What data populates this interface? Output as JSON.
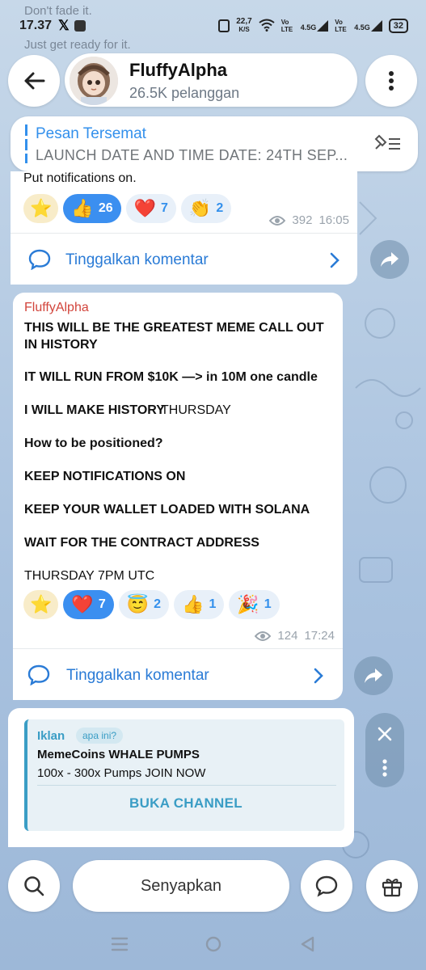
{
  "status_bar": {
    "notif_line1": "Don't fade it.",
    "notif_line2": "Just get ready for it.",
    "time": "17.37",
    "speed_value": "22,7",
    "speed_unit": "K/S",
    "sim1": "Vo LTE",
    "net1": "4.5G",
    "sim2": "Vo LTE",
    "net2": "4.5G",
    "battery": "32"
  },
  "header": {
    "channel_name": "FluffyAlpha",
    "subscribers": "26.5K pelanggan"
  },
  "pinned": {
    "title": "Pesan Tersemat",
    "text": "LAUNCH DATE AND TIME  DATE: 24TH SEP..."
  },
  "message1": {
    "text": "Put notifications on.",
    "reactions": [
      {
        "emoji": "⭐",
        "count": ""
      },
      {
        "emoji": "👍",
        "count": "26"
      },
      {
        "emoji": "❤️",
        "count": "7"
      },
      {
        "emoji": "👏",
        "count": "2"
      }
    ],
    "views": "392",
    "time": "16:05",
    "comment_label": "Tinggalkan komentar"
  },
  "message2": {
    "author": "FluffyAlpha",
    "lines": [
      "THIS WILL BE THE GREATEST MEME CALL OUT",
      "IN HISTORY",
      "IT WILL RUN FROM $10K —> in 10M one candle",
      "I WILL MAKE HISTORY",
      "THURSDAY",
      "How to be positioned?",
      "KEEP NOTIFICATIONS ON",
      "KEEP YOUR WALLET LOADED WITH SOLANA",
      "WAIT FOR THE CONTRACT ADDRESS",
      "THURSDAY 7PM UTC"
    ],
    "reactions": [
      {
        "emoji": "⭐",
        "count": ""
      },
      {
        "emoji": "❤️",
        "count": "7"
      },
      {
        "emoji": "😇",
        "count": "2"
      },
      {
        "emoji": "👍",
        "count": "1"
      },
      {
        "emoji": "🎉",
        "count": "1"
      }
    ],
    "views": "124",
    "time": "17:24",
    "comment_label": "Tinggalkan komentar"
  },
  "ad": {
    "label": "Iklan",
    "badge": "apa ini?",
    "title": "MemeCoins WHALE PUMPS",
    "description": "100x - 300x Pumps JOIN NOW",
    "button": "BUKA CHANNEL"
  },
  "bottom_bar": {
    "mute_label": "Senyapkan"
  },
  "colors": {
    "accent": "#3390ec",
    "author": "#d2453c",
    "ad_accent": "#3a9dc5"
  }
}
